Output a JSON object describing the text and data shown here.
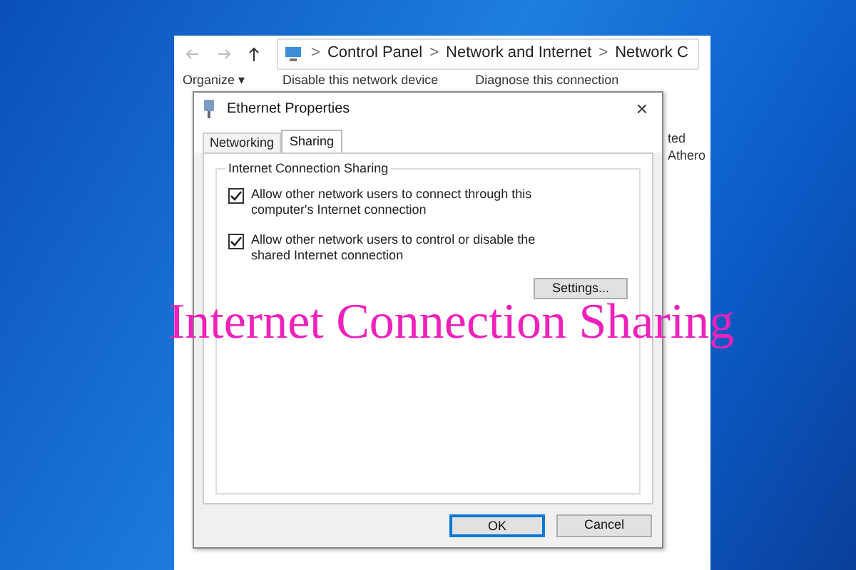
{
  "explorer": {
    "breadcrumbs": [
      "Control Panel",
      "Network and Internet",
      "Network C"
    ],
    "separator": ">",
    "toolbar": [
      "Organize ▾",
      "Disable this network device",
      "Diagnose this connection"
    ],
    "side_text": [
      "ted",
      "Athero"
    ]
  },
  "dialog": {
    "title": "Ethernet Properties",
    "close": "×",
    "tabs": [
      {
        "label": "Networking",
        "selected": false
      },
      {
        "label": "Sharing",
        "selected": true
      }
    ],
    "group": "Internet Connection Sharing",
    "options": [
      {
        "label": "Allow other network users to connect through this computer's Internet connection",
        "checked": true
      },
      {
        "label": "Allow other network users to control or disable the shared Internet connection",
        "checked": true
      }
    ],
    "settings_button": "Settings...",
    "buttons": [
      {
        "label": "OK",
        "default": true
      },
      {
        "label": "Cancel",
        "default": false
      }
    ]
  },
  "overlay_title": "Internet Connection Sharing"
}
